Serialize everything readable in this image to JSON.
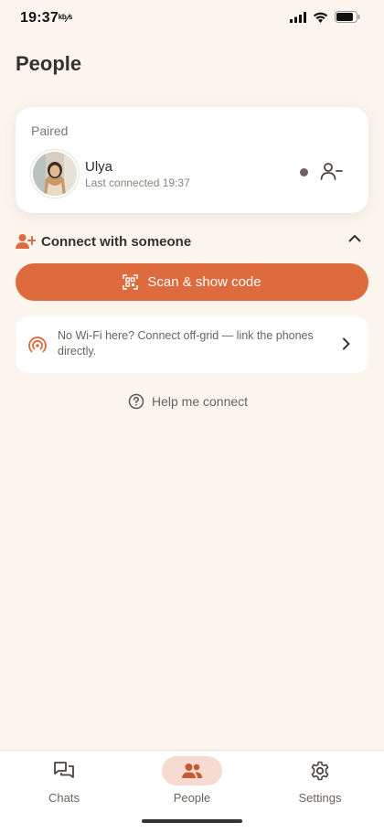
{
  "status_bar": {
    "time": "19:37",
    "extra": "ᵏᵇ⁄ˢ"
  },
  "page": {
    "title": "People"
  },
  "paired": {
    "label": "Paired",
    "contact": {
      "name": "Ulya",
      "last_connected": "Last connected 19:37"
    }
  },
  "connect": {
    "title": "Connect with someone",
    "scan_button": "Scan & show code",
    "offgrid_text": "No Wi-Fi here? Connect off-grid — link the phones directly.",
    "help_link": "Help me connect"
  },
  "nav": {
    "items": [
      {
        "label": "Chats",
        "icon": "chat-icon"
      },
      {
        "label": "People",
        "icon": "people-icon"
      },
      {
        "label": "Settings",
        "icon": "gear-icon"
      }
    ],
    "active": "People"
  },
  "colors": {
    "accent": "#dd6b3e",
    "background": "#fbf5ee",
    "nav_active_bg": "#f8dbd0"
  }
}
